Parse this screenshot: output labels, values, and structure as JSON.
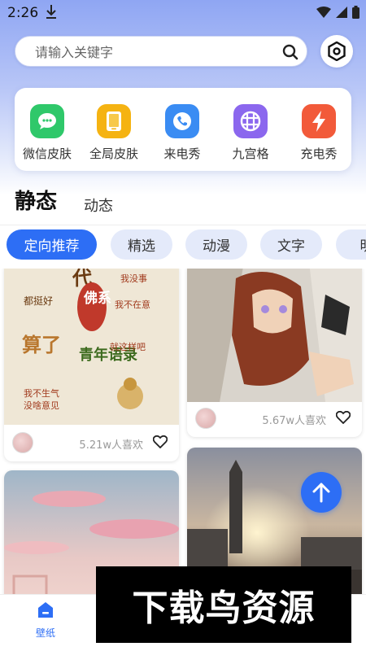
{
  "status_bar": {
    "time": "2:26"
  },
  "search": {
    "placeholder": "请输入关键字"
  },
  "features": [
    {
      "label": "微信皮肤",
      "icon": "wechat-icon",
      "color": "#2fc86a"
    },
    {
      "label": "全局皮肤",
      "icon": "skin-icon",
      "color": "#f5b312"
    },
    {
      "label": "来电秀",
      "icon": "phone-icon",
      "color": "#3a8cf3"
    },
    {
      "label": "九宫格",
      "icon": "grid-icon",
      "color": "#8b67ee"
    },
    {
      "label": "充电秀",
      "icon": "charge-icon",
      "color": "#f25a3a"
    }
  ],
  "type_tabs": {
    "active": "静态",
    "other": "动态"
  },
  "chips": [
    "定向推荐",
    "精选",
    "动漫",
    "文字",
    "明"
  ],
  "cards": [
    {
      "likes": "5.21w人喜欢"
    },
    {
      "likes": "5.67w人喜欢"
    }
  ],
  "poster_text": {
    "big": "佛系",
    "line1": "青年语录",
    "lines": [
      "我没事",
      "都挺好",
      "算了",
      "就这样吧",
      "我不在意",
      "我不生气",
      "没啥意见"
    ]
  },
  "bottom_nav": {
    "label": "壁纸"
  },
  "watermark": "下载鸟资源",
  "colors": {
    "accent": "#2d6ef5"
  }
}
